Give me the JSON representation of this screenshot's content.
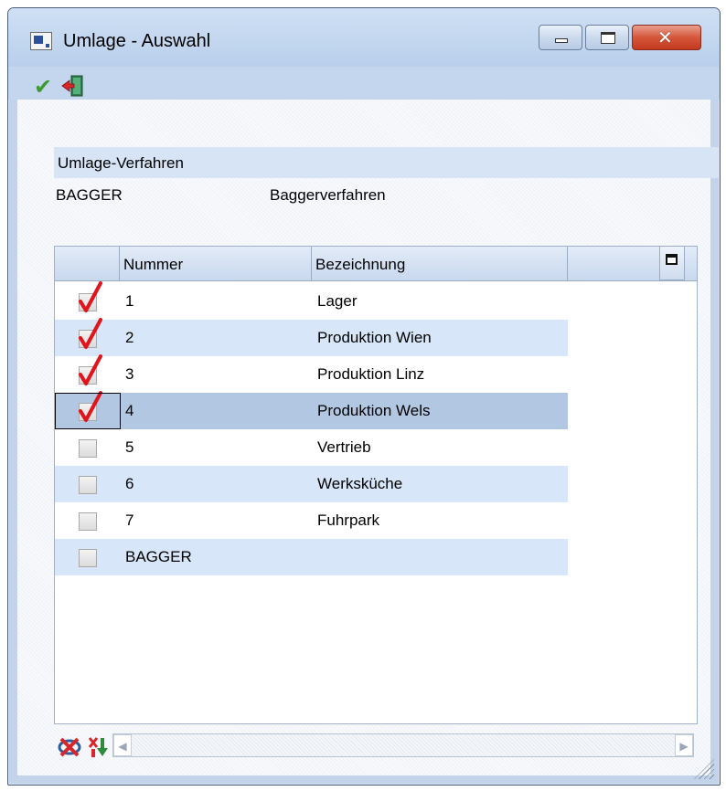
{
  "window": {
    "title": "Umlage - Auswahl",
    "buttons": {
      "minimize": "minimize",
      "maximize": "maximize",
      "close": "close"
    }
  },
  "toolbar": {
    "items": [
      {
        "icon": "checkmark-icon",
        "name": "ok"
      },
      {
        "icon": "exit-door-icon",
        "name": "exit"
      }
    ]
  },
  "section": {
    "label": "Umlage-Verfahren",
    "code": "BAGGER",
    "description": "Baggerverfahren"
  },
  "grid": {
    "columns": [
      "",
      "Nummer",
      "Bezeichnung"
    ],
    "rows": [
      {
        "checked": true,
        "nummer": "1",
        "bezeichnung": "Lager"
      },
      {
        "checked": true,
        "nummer": "2",
        "bezeichnung": "Produktion Wien"
      },
      {
        "checked": true,
        "nummer": "3",
        "bezeichnung": "Produktion Linz"
      },
      {
        "checked": true,
        "nummer": "4",
        "bezeichnung": "Produktion Wels",
        "selected": true
      },
      {
        "checked": false,
        "nummer": "5",
        "bezeichnung": "Vertrieb"
      },
      {
        "checked": false,
        "nummer": "6",
        "bezeichnung": "Werksküche"
      },
      {
        "checked": false,
        "nummer": "7",
        "bezeichnung": "Fuhrpark"
      },
      {
        "checked": false,
        "nummer": "BAGGER",
        "bezeichnung": ""
      }
    ]
  },
  "colors": {
    "frame": "#c2d3ea",
    "row_alt": "#d7e6f8",
    "row_selected": "#b2c7e1",
    "check_mark": "#e0141a"
  }
}
